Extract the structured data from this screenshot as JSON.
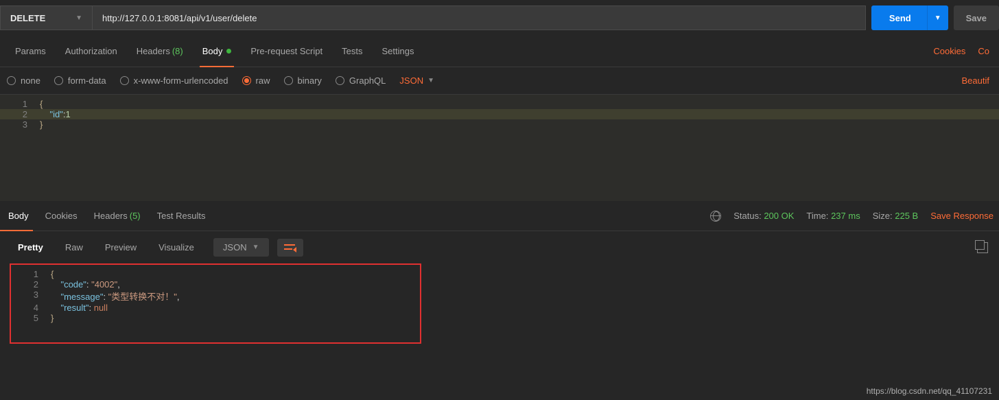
{
  "request": {
    "method": "DELETE",
    "url": "http://127.0.0.1:8081/api/v1/user/delete",
    "sendLabel": "Send",
    "saveLabel": "Save",
    "tabs": {
      "params": "Params",
      "auth": "Authorization",
      "headers": "Headers",
      "headersCount": "(8)",
      "body": "Body",
      "prerequest": "Pre-request Script",
      "tests": "Tests",
      "settings": "Settings"
    },
    "rightLinks": {
      "cookies": "Cookies",
      "code": "Co"
    },
    "bodyTypes": {
      "none": "none",
      "formData": "form-data",
      "urlencoded": "x-www-form-urlencoded",
      "raw": "raw",
      "binary": "binary",
      "graphql": "GraphQL"
    },
    "rawType": "JSON",
    "beautify": "Beautif",
    "body": {
      "l1": "{",
      "l2key": "\"id\"",
      "l2val": "1",
      "l3": "}"
    }
  },
  "response": {
    "tabs": {
      "body": "Body",
      "cookies": "Cookies",
      "headers": "Headers",
      "headersCount": "(5)",
      "tests": "Test Results"
    },
    "status": {
      "label": "Status:",
      "value": "200 OK"
    },
    "time": {
      "label": "Time:",
      "value": "237 ms"
    },
    "size": {
      "label": "Size:",
      "value": "225 B"
    },
    "save": "Save Response",
    "views": {
      "pretty": "Pretty",
      "raw": "Raw",
      "preview": "Preview",
      "visualize": "Visualize"
    },
    "respType": "JSON",
    "body": {
      "codeKey": "\"code\"",
      "codeVal": "\"4002\"",
      "msgKey": "\"message\"",
      "msgVal": "\"类型转换不对！\"",
      "resKey": "\"result\"",
      "resVal": "null"
    }
  },
  "footer": "https://blog.csdn.net/qq_41107231"
}
